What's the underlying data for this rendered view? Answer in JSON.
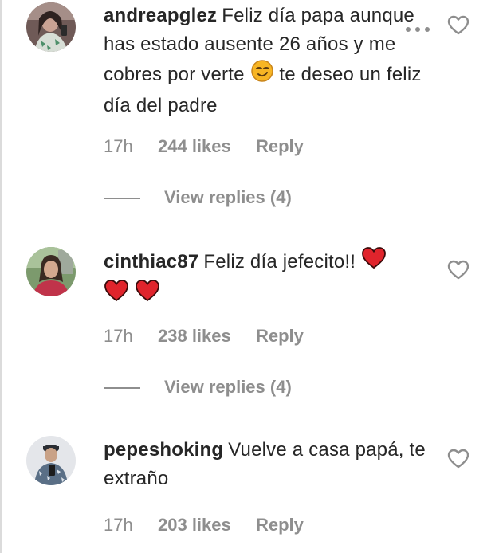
{
  "comments": [
    {
      "username": "andreapglez",
      "text_a": "Feliz día papa aunque has estado ausente 26 años y me cobres por verte",
      "emoji": "smirk-emoji",
      "text_b": "te deseo un feliz día del padre",
      "time": "17h",
      "likes": "244 likes",
      "reply": "Reply",
      "view_replies": "View replies (4)"
    },
    {
      "username": "cinthiac87",
      "text_a": "Feliz día jefecito!!",
      "emoji": "red-heart-emoji",
      "time": "17h",
      "likes": "238 likes",
      "reply": "Reply",
      "view_replies": "View replies (4)"
    },
    {
      "username": "pepeshoking",
      "text_a": "Vuelve a casa papá, te extraño",
      "time": "17h",
      "likes": "203 likes",
      "reply": "Reply"
    }
  ],
  "icons": {
    "more": "more-options-icon",
    "like": "heart-outline-icon"
  },
  "colors": {
    "text": "#262626",
    "muted": "#8e8e8e",
    "heart_red": "#e0242c",
    "emoji_yellow": "#f7b524"
  }
}
